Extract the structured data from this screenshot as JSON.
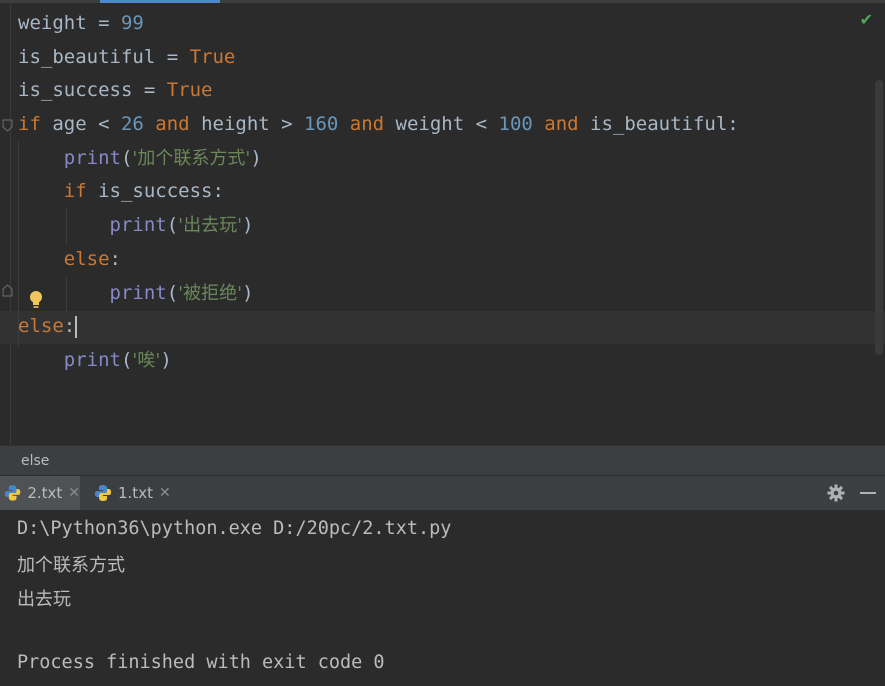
{
  "editor": {
    "lines": [
      [
        {
          "t": "weight = ",
          "c": "p"
        },
        {
          "t": "99",
          "c": "num"
        }
      ],
      [
        {
          "t": "is_beautiful = ",
          "c": "p"
        },
        {
          "t": "True",
          "c": "kw"
        }
      ],
      [
        {
          "t": "is_success = ",
          "c": "p"
        },
        {
          "t": "True",
          "c": "kw"
        }
      ],
      [
        {
          "t": "if ",
          "c": "kw"
        },
        {
          "t": "age < ",
          "c": "p"
        },
        {
          "t": "26",
          "c": "num"
        },
        {
          "t": " and ",
          "c": "kw"
        },
        {
          "t": "height > ",
          "c": "p"
        },
        {
          "t": "160",
          "c": "num"
        },
        {
          "t": " and ",
          "c": "kw"
        },
        {
          "t": "weight < ",
          "c": "p"
        },
        {
          "t": "100",
          "c": "num"
        },
        {
          "t": " and ",
          "c": "kw"
        },
        {
          "t": "is_beautiful:",
          "c": "p"
        }
      ],
      [
        {
          "t": "    ",
          "c": "p"
        },
        {
          "t": "print",
          "c": "fn"
        },
        {
          "t": "(",
          "c": "p"
        },
        {
          "t": "'加个联系方式'",
          "c": "str zh"
        },
        {
          "t": ")",
          "c": "p"
        }
      ],
      [
        {
          "t": "    ",
          "c": "p"
        },
        {
          "t": "if ",
          "c": "kw"
        },
        {
          "t": "is_success:",
          "c": "p"
        }
      ],
      [
        {
          "t": "        ",
          "c": "p"
        },
        {
          "t": "print",
          "c": "fn"
        },
        {
          "t": "(",
          "c": "p"
        },
        {
          "t": "'出去玩'",
          "c": "str zh"
        },
        {
          "t": ")",
          "c": "p"
        }
      ],
      [
        {
          "t": "    ",
          "c": "p"
        },
        {
          "t": "else",
          "c": "kw"
        },
        {
          "t": ":",
          "c": "p"
        }
      ],
      [
        {
          "t": "        ",
          "c": "p"
        },
        {
          "t": "print",
          "c": "fn"
        },
        {
          "t": "(",
          "c": "p"
        },
        {
          "t": "'被拒绝'",
          "c": "str zh"
        },
        {
          "t": ")",
          "c": "p"
        }
      ],
      [
        {
          "t": "else",
          "c": "kw"
        },
        {
          "t": ":",
          "c": "p"
        },
        {
          "t": "",
          "c": "caret"
        }
      ],
      [
        {
          "t": "    ",
          "c": "p"
        },
        {
          "t": "print",
          "c": "fn"
        },
        {
          "t": "(",
          "c": "p"
        },
        {
          "t": "'唉'",
          "c": "str zh"
        },
        {
          "t": ")",
          "c": "p"
        }
      ]
    ]
  },
  "breadcrumb": {
    "label": "else"
  },
  "run_tabs": [
    {
      "label": "2.txt",
      "active": true
    },
    {
      "label": "1.txt",
      "active": false
    }
  ],
  "console": {
    "lines": [
      "D:\\Python36\\python.exe D:/20pc/2.txt.py",
      "加个联系方式",
      "出去玩",
      "",
      "Process finished with exit code 0"
    ]
  },
  "colors": {
    "background": "#2b2b2b",
    "keyword": "#cc7832",
    "number": "#6897bb",
    "builtin": "#8888c6",
    "string": "#6a8759",
    "text": "#a9b7c6",
    "check": "#4fa857"
  },
  "icons": [
    "check-icon",
    "fold-icon",
    "bulb-icon",
    "python-file-icon",
    "close-icon",
    "gear-icon",
    "minimize-icon"
  ]
}
